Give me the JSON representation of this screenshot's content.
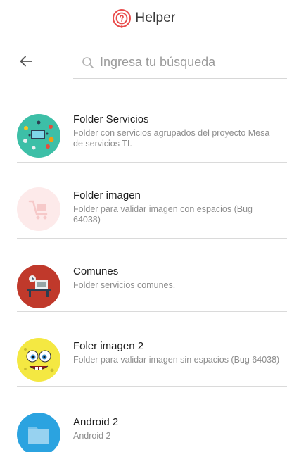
{
  "header": {
    "app_name": "Helper",
    "accent": "#e94b4b"
  },
  "search": {
    "placeholder": "Ingresa tu búsqueda",
    "value": ""
  },
  "items": [
    {
      "title": "Folder Servicios",
      "description": "Folder con servicios agrupados del proyecto Mesa de servicios TI.",
      "icon": "services-icon",
      "color": "#3dbfa7"
    },
    {
      "title": "Folder imagen",
      "description": "Folder para validar imagen con espacios (Bug 64038)",
      "icon": "cart-icon",
      "color": "#fdeaea"
    },
    {
      "title": "Comunes",
      "description": "Folder servicios comunes.",
      "icon": "desk-icon",
      "color": "#c0392b"
    },
    {
      "title": "Foler imagen 2",
      "description": "Folder para validar imagen sin espacios (Bug 64038)",
      "icon": "sponge-icon",
      "color": "#f4e842"
    },
    {
      "title": "Android 2",
      "description": "Android 2",
      "icon": "folder-icon",
      "color": "#2ba3e0"
    }
  ]
}
